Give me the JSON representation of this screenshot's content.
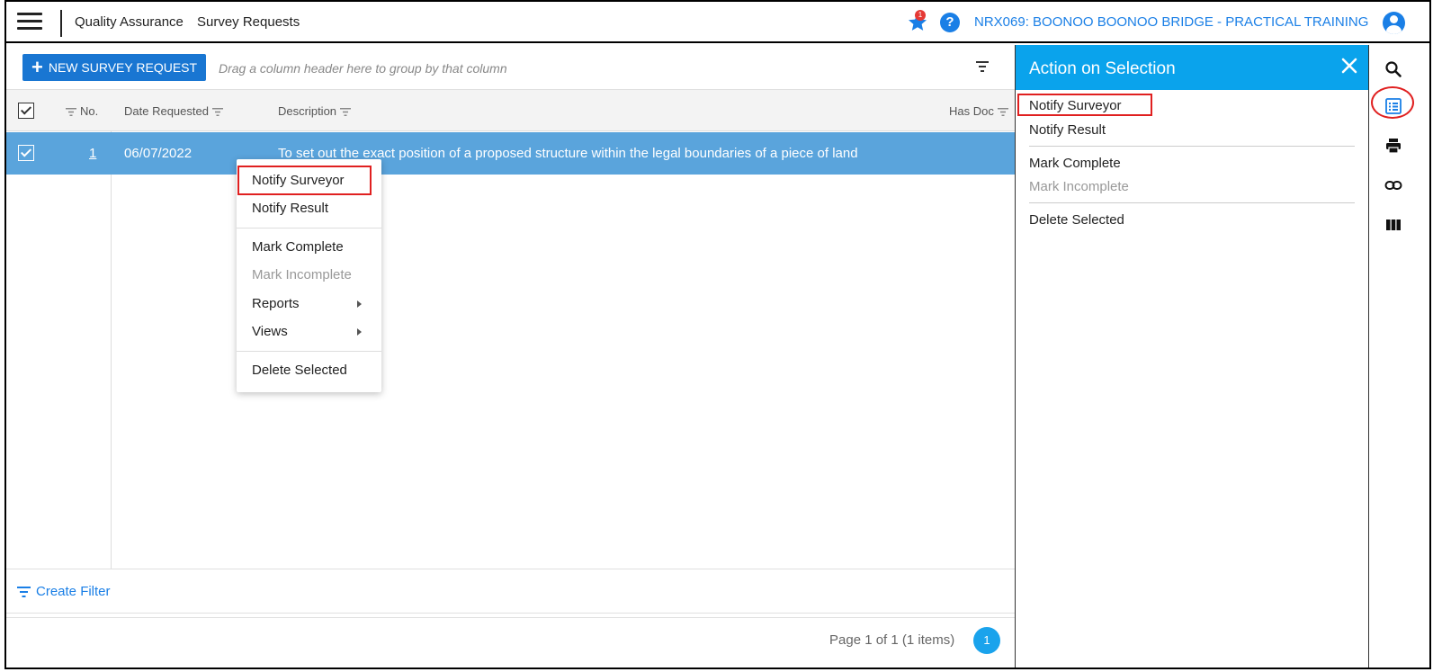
{
  "header": {
    "breadcrumb": [
      "Quality Assurance",
      "Survey Requests"
    ],
    "notification_count": "1",
    "help_label": "?",
    "project": "NRX069: BOONOO BOONOO BRIDGE - PRACTICAL TRAINING"
  },
  "toolbar": {
    "new_button_plus": "+",
    "new_button_label": "NEW SURVEY REQUEST",
    "group_hint": "Drag a column header here to group by that column"
  },
  "columns": {
    "no": "No.",
    "date_requested": "Date Requested",
    "description": "Description",
    "has_doc": "Has Doc"
  },
  "rows": [
    {
      "no": "1",
      "date_requested": "06/07/2022",
      "description": "To set out the exact position of a proposed structure within the legal boundaries of a piece of land",
      "selected": true
    }
  ],
  "context_menu": {
    "items": [
      "Notify Surveyor",
      "Notify Result",
      "Mark Complete",
      "Mark Incomplete",
      "Reports",
      "Views",
      "Delete Selected"
    ],
    "disabled": [
      "Mark Incomplete"
    ]
  },
  "footer": {
    "create_filter": "Create Filter",
    "page_info": "Page 1 of 1 (1 items)",
    "current_page": "1"
  },
  "action_panel": {
    "title": "Action on Selection",
    "items": [
      "Notify Surveyor",
      "Notify Result",
      "Mark Complete",
      "Mark Incomplete",
      "Delete Selected"
    ],
    "disabled": [
      "Mark Incomplete"
    ]
  },
  "rail_icons": [
    "search-icon",
    "list-icon",
    "print-icon",
    "link-icon",
    "columns-icon"
  ],
  "colors": {
    "accent": "#1a7fe6",
    "panel_header": "#0aa3ec",
    "selected_row": "#5aa4dc",
    "primary_button": "#1976d2",
    "highlight": "#e02020"
  }
}
